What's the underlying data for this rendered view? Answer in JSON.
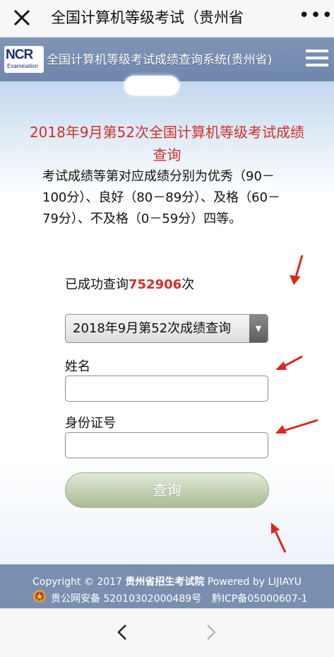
{
  "topbar": {
    "title": "全国计算机等级考试（贵州省"
  },
  "site": {
    "logo_main": "NCR",
    "logo_sub": "Examination",
    "title": "全国计算机等级考试成绩查询系统(贵州省)"
  },
  "main": {
    "page_title": "2018年9月第52次全国计算机等级考试成绩查询",
    "description": "考试成绩等第对应成绩分别为优秀（90－100分）、良好（80－89分）、及格（60－79分）、不及格（0－59分）四等。",
    "count_prefix": "已成功查询",
    "count_value": "752906",
    "count_suffix": "次",
    "select_value": "2018年9月第52次成绩查询",
    "name_label": "姓名",
    "name_value": "",
    "id_label": "身份证号",
    "id_value": "",
    "query_button": "查询"
  },
  "footer": {
    "copyright_prefix": "Copyright © 2017",
    "org": "贵州省招生考试院",
    "powered": "Powered by LIJIAYU",
    "ga_record": "贵公网安备 52010302000489号",
    "icp_record": "黔ICP备05000607-1"
  },
  "colors": {
    "accent_red": "#d0302a",
    "header_blue": "#7a8faf",
    "button_green": "#b7c8a6"
  }
}
